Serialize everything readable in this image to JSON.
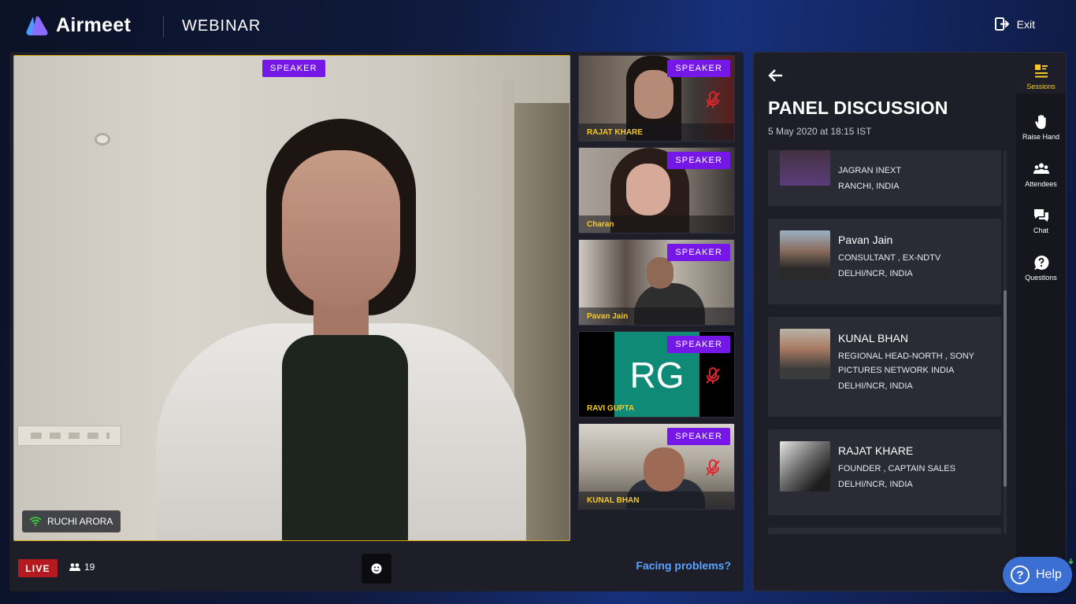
{
  "app": {
    "brand": "Airmeet",
    "event_type": "WEBINAR",
    "exit_label": "Exit"
  },
  "stage": {
    "main_speaker": {
      "badge": "SPEAKER",
      "name": "RUCHI ARORA"
    },
    "tiles": [
      {
        "badge": "SPEAKER",
        "name": "RAJAT KHARE",
        "muted": true
      },
      {
        "badge": "SPEAKER",
        "name": "Charan",
        "muted": false
      },
      {
        "badge": "SPEAKER",
        "name": "Pavan Jain",
        "muted": false
      },
      {
        "badge": "SPEAKER",
        "name": "RAVI GUPTA",
        "muted": true,
        "initials": "RG"
      },
      {
        "badge": "SPEAKER",
        "name": "KUNAL BHAN",
        "muted": true
      }
    ],
    "live_label": "LIVE",
    "attendee_count": "19",
    "facing_problems": "Facing problems?"
  },
  "panel": {
    "title": "PANEL DISCUSSION",
    "date": "5 May 2020 at 18:15 IST",
    "speakers": [
      {
        "name": "",
        "lines": [
          "JAGRAN INEXT",
          "RANCHI, INDIA"
        ]
      },
      {
        "name": "Pavan Jain",
        "lines": [
          "CONSULTANT , EX-NDTV",
          "DELHI/NCR, INDIA"
        ]
      },
      {
        "name": "KUNAL BHAN",
        "lines": [
          "REGIONAL HEAD-NORTH , SONY PICTURES NETWORK INDIA",
          "DELHI/NCR, INDIA"
        ]
      },
      {
        "name": "RAJAT KHARE",
        "lines": [
          "FOUNDER , CAPTAIN SALES",
          "DELHI/NCR, INDIA"
        ]
      }
    ],
    "rail": [
      {
        "label": "Sessions",
        "icon": "sessions-icon",
        "active": true
      },
      {
        "label": "Raise Hand",
        "icon": "raise-hand-icon"
      },
      {
        "label": "Attendees",
        "icon": "attendees-icon"
      },
      {
        "label": "Chat",
        "icon": "chat-icon"
      },
      {
        "label": "Questions",
        "icon": "questions-icon"
      }
    ]
  },
  "help": {
    "label": "Help"
  },
  "colors": {
    "speaker_badge": "#7517e6",
    "live": "#b51a20",
    "accent_yellow": "#f7c928",
    "link_blue": "#5aa2ff",
    "help": "#3b6fd1"
  }
}
